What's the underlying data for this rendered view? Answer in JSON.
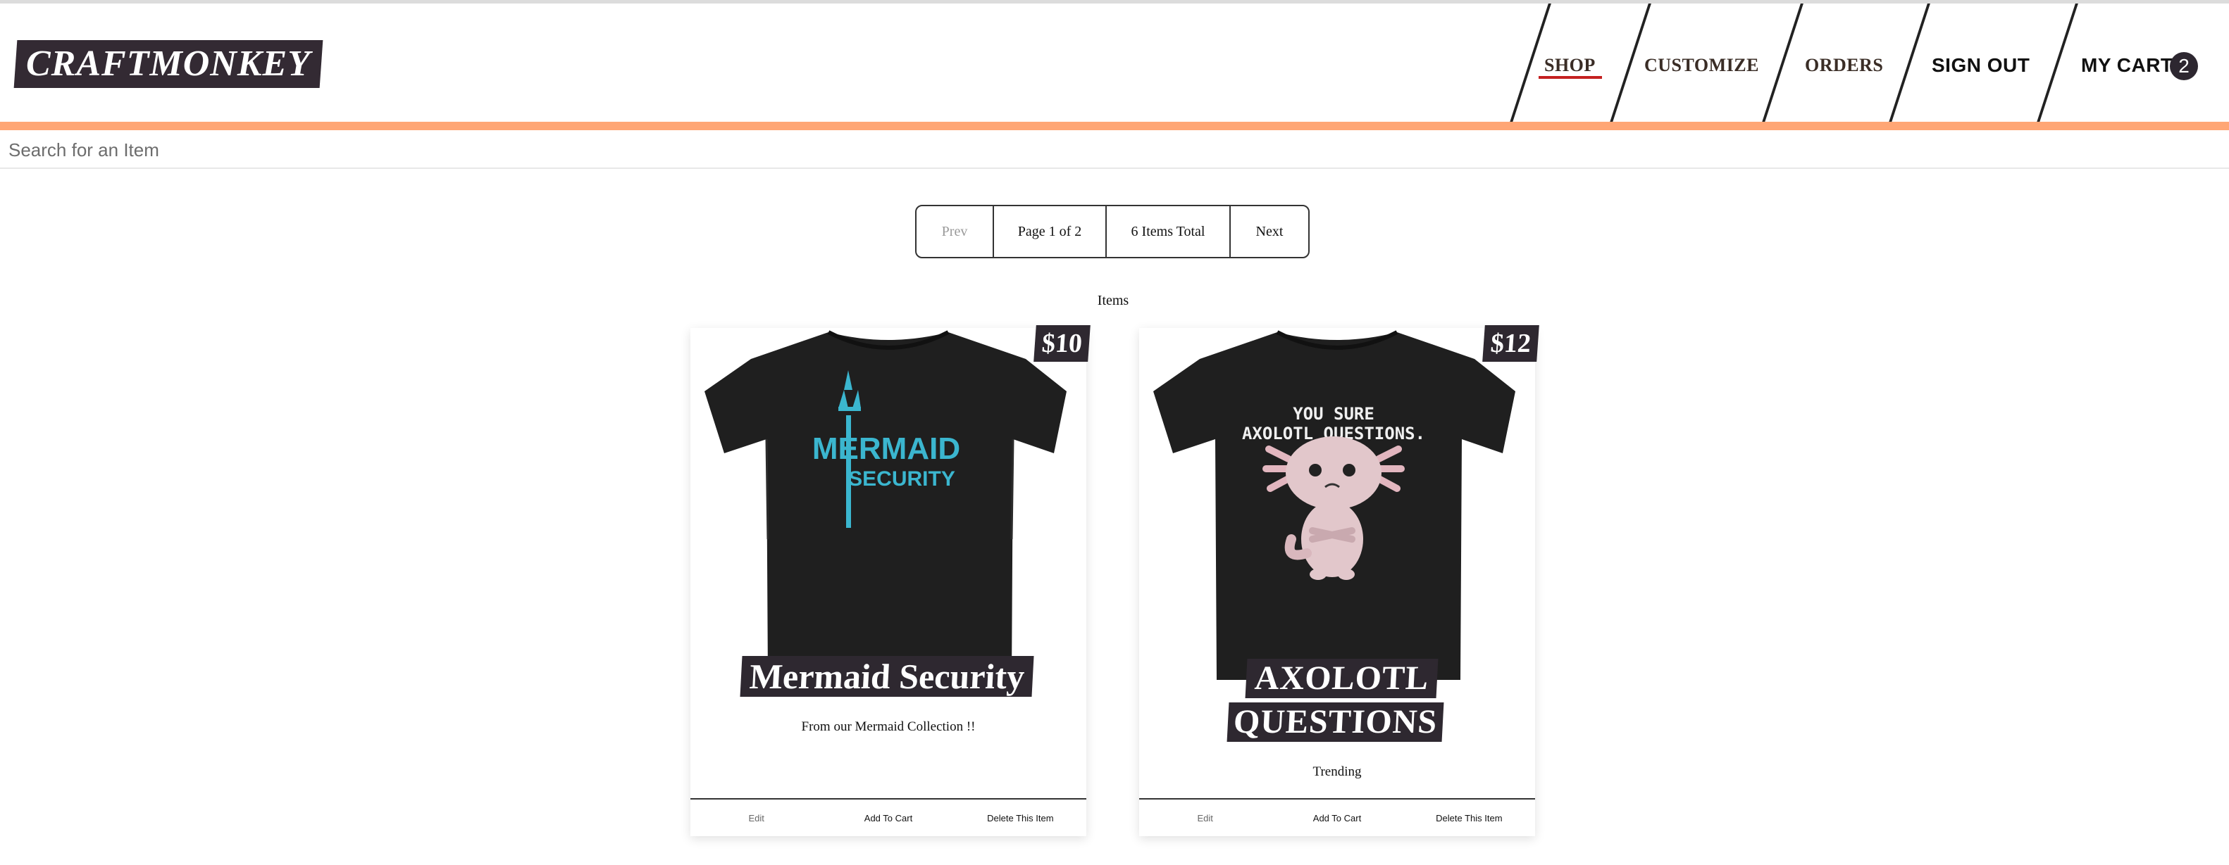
{
  "brand": {
    "logo": "CRAFTMONKEY"
  },
  "nav": {
    "shop": "SHOP",
    "customize": "CUSTOMIZE",
    "orders": "ORDERS",
    "sign_out": "SIGN OUT",
    "cart": "MY CART",
    "cart_count": "2"
  },
  "search": {
    "placeholder": "Search for an Item",
    "value": ""
  },
  "pagination": {
    "prev": "Prev",
    "page": "Page 1 of 2",
    "total": "6 Items Total",
    "next": "Next"
  },
  "items_heading": "Items",
  "items": [
    {
      "price": "$10",
      "title": "Mermaid Security",
      "description": "From our Mermaid Collection !!",
      "shirt_print": {
        "line1": "MERMAID",
        "line2": "SECURITY",
        "color": "#3bb6cf"
      },
      "actions": {
        "edit": "Edit",
        "add": "Add To Cart",
        "delete": "Delete This Item"
      }
    },
    {
      "price": "$12",
      "title_line1": "AXOLOTL",
      "title_line2": "QUESTIONS",
      "description": "Trending",
      "shirt_print": {
        "line1": "YOU SURE",
        "line2": "AXOLOTL QUESTIONS.",
        "color": "#f0f0f0"
      },
      "actions": {
        "edit": "Edit",
        "add": "Add To Cart",
        "delete": "Delete This Item"
      }
    }
  ],
  "colors": {
    "brand_dark": "#2e2830",
    "accent_orange": "#ffa675",
    "active_underline": "#c42020",
    "shirt": "#1f1f1f",
    "axolotl_pink": "#e2c7cb"
  }
}
